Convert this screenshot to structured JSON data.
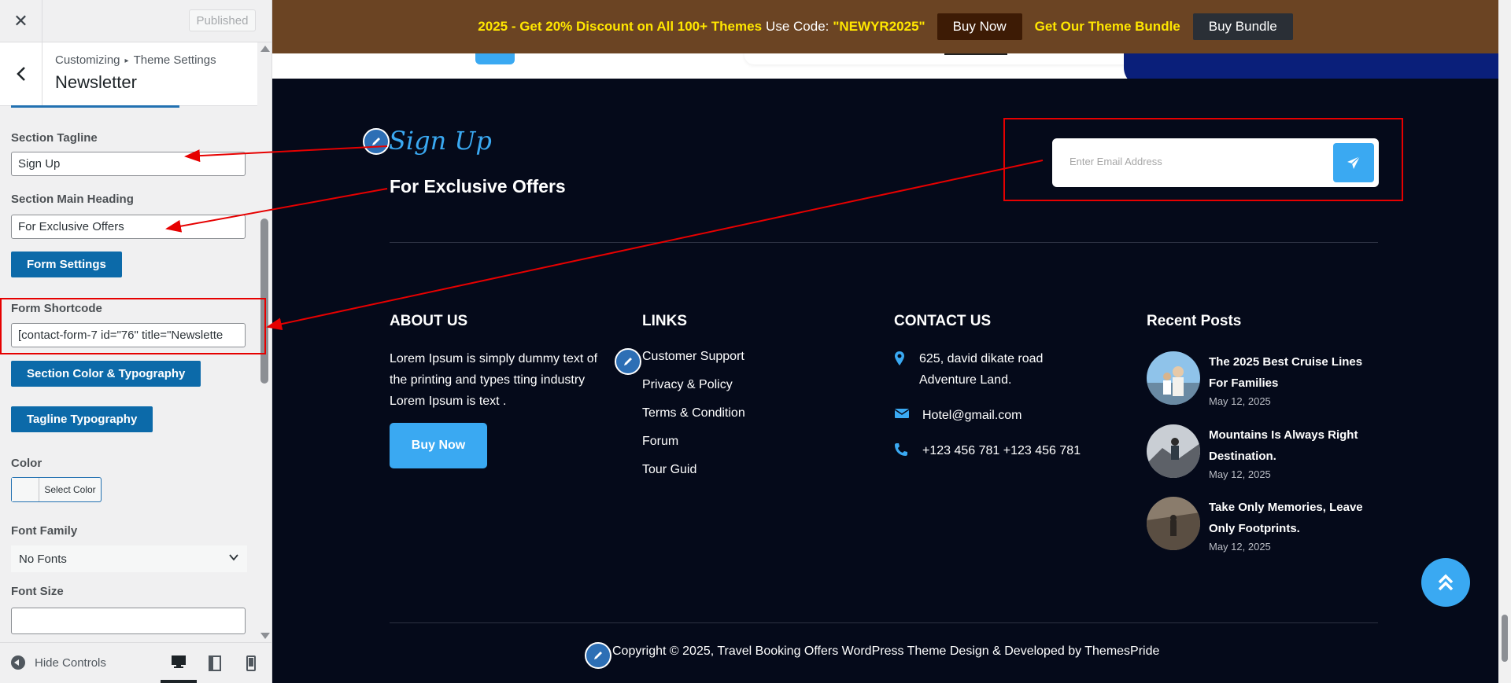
{
  "sidebar": {
    "close_icon": "close-icon",
    "published_label": "Published",
    "breadcrumb_root": "Customizing",
    "breadcrumb_section": "Theme Settings",
    "panel_title": "Newsletter",
    "fields": {
      "tagline_label": "Section Tagline",
      "tagline_value": "Sign Up",
      "heading_label": "Section Main Heading",
      "heading_value": "For Exclusive Offers",
      "form_settings_button": "Form Settings",
      "shortcode_label": "Form Shortcode",
      "shortcode_value": "[contact-form-7 id=\"76\" title=\"Newslette",
      "color_typo_button": "Section Color & Typography",
      "tagline_typo_button": "Tagline Typography",
      "color_label": "Color",
      "select_color": "Select Color",
      "font_family_label": "Font Family",
      "font_family_value": "No Fonts",
      "font_size_label": "Font Size",
      "font_size_value": ""
    },
    "footer": {
      "hide_controls": "Hide Controls",
      "devices": [
        "desktop",
        "tablet",
        "mobile"
      ],
      "active_device": "desktop"
    }
  },
  "promo": {
    "offer": "2025 - Get 20% Discount on All 100+ Themes",
    "use_code_text": "Use Code:",
    "code": "\"NEWYR2025\"",
    "buy_now": "Buy Now",
    "bundle_text": "Get Our Theme Bundle",
    "buy_bundle": "Buy Bundle"
  },
  "newsletter": {
    "tagline": "Sign Up",
    "heading": "For Exclusive Offers",
    "email_placeholder": "Enter Email Address"
  },
  "footer": {
    "about": {
      "title": "ABOUT US",
      "text": "Lorem Ipsum is simply dummy text of the printing and types tting industry Lorem Ipsum is text .",
      "button": "Buy Now"
    },
    "links": {
      "title": "LINKS",
      "items": [
        "Customer Support",
        "Privacy & Policy",
        "Terms & Condition",
        "Forum",
        "Tour Guid"
      ]
    },
    "contact": {
      "title": "CONTACT US",
      "address_line1": "625, david dikate road",
      "address_line2": "Adventure Land.",
      "email": "Hotel@gmail.com",
      "phone": "+123 456 781 +123 456 781"
    },
    "recent": {
      "title": "Recent Posts",
      "posts": [
        {
          "title": "The 2025 Best Cruise Lines For Families",
          "date": "May 12, 2025"
        },
        {
          "title": "Mountains Is Always Right Destination.",
          "date": "May 12, 2025"
        },
        {
          "title": "Take Only Memories, Leave Only Footprints.",
          "date": "May 12, 2025"
        }
      ]
    },
    "copyright": "Copyright © 2025, Travel Booking Offers WordPress Theme Design & Developed by ThemesPride"
  },
  "colors": {
    "accent": "#3aa9f2",
    "promo_bg": "#6b4423",
    "promo_highlight": "#ffe600",
    "footer_bg": "#050a1a",
    "wp_button": "#0c6aa9",
    "annotation": "#e60000"
  }
}
